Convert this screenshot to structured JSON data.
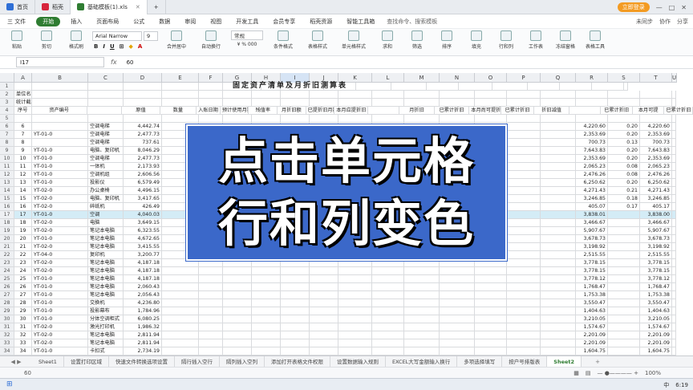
{
  "titlebar": {
    "tabs": [
      {
        "label": "首页",
        "color": "#2f6fd6"
      },
      {
        "label": "稻壳",
        "color": "#d7263d"
      },
      {
        "label": "基础模板(1).xls",
        "color": "#2f7d32"
      }
    ],
    "login_label": "立即登录"
  },
  "menubar": {
    "file": "三 文件",
    "items": [
      "开始",
      "插入",
      "页面布局",
      "公式",
      "数据",
      "审阅",
      "视图",
      "开发工具",
      "会员专享",
      "稻壳资源",
      "智能工具箱"
    ],
    "search": "查找命令、搜索模板",
    "right": [
      "未同步",
      "协作",
      "分享"
    ]
  },
  "ribbon": {
    "paste": "粘贴",
    "cut": "剪切",
    "copy": "复制",
    "format_painter": "格式刷",
    "font_name": "Arial Narrow",
    "font_size": "9",
    "merge": "合并居中",
    "wrap": "自动换行",
    "general": "常规",
    "conditional": "条件格式",
    "table_style": "表格样式",
    "cell_style": "单元格样式",
    "sum": "求和",
    "filter": "筛选",
    "sort": "排序",
    "fill": "填充",
    "row_col": "行和列",
    "worksheet": "工作表",
    "freeze": "冻结窗格",
    "table_tools": "表格工具"
  },
  "formula": {
    "namebox": "I17",
    "fx": "fx",
    "value": "60"
  },
  "columns": [
    "A",
    "B",
    "C",
    "D",
    "E",
    "F",
    "G",
    "H",
    "I",
    "J",
    "K",
    "L",
    "M",
    "N",
    "O",
    "P",
    "Q",
    "R",
    "S",
    "T",
    "U"
  ],
  "sheet": {
    "title": "固定资产清单及月折旧测算表",
    "row2": "单位名称：",
    "row3": "统计截止日：",
    "headers": [
      "序号",
      "资产编号",
      "",
      "原值",
      "数量",
      "入账日期",
      "预计使用月数",
      "残值率",
      "月折旧额",
      "已提折旧月数",
      "本月应提折旧",
      "",
      "月折旧",
      "已累计折旧",
      "本月尚可提折旧额",
      "已累计折旧",
      "折旧减值",
      "",
      "已累计折旧",
      "本月可提",
      "已累计折旧"
    ],
    "rows": [
      {
        "n": "6",
        "no": "6",
        "code": "",
        "name": "空调电梯",
        "orig": "4,442.74",
        "r": "4,220.60",
        "s": "0.20",
        "t": "4,220.60"
      },
      {
        "n": "7",
        "no": "7",
        "code": "YT-01-0",
        "name": "空调电梯",
        "orig": "2,477.73",
        "r": "2,353.69",
        "s": "0.20",
        "t": "2,353.69"
      },
      {
        "n": "8",
        "no": "8",
        "code": "",
        "name": "空调电梯",
        "orig": "737.61",
        "r": "700.73",
        "s": "0.13",
        "t": "700.73"
      },
      {
        "n": "9",
        "no": "9",
        "code": "YT-01-0",
        "name": "电脑、复印机",
        "orig": "8,046.29",
        "r": "7,643.83",
        "s": "0.20",
        "t": "7,643.83"
      },
      {
        "n": "10",
        "no": "10",
        "code": "YT-01-0",
        "name": "空调电梯",
        "orig": "2,477.73",
        "r": "2,353.69",
        "s": "0.20",
        "t": "2,353.69"
      },
      {
        "n": "11",
        "no": "11",
        "code": "YT-01-0",
        "name": "一体机",
        "orig": "2,173.93",
        "r": "2,065.23",
        "s": "0.08",
        "t": "2,065.23"
      },
      {
        "n": "12",
        "no": "12",
        "code": "YT-01-0",
        "name": "空调机组",
        "orig": "2,606.56",
        "r": "2,476.26",
        "s": "0.08",
        "t": "2,476.26"
      },
      {
        "n": "13",
        "no": "13",
        "code": "YT-01-0",
        "name": "投影仪",
        "orig": "6,579.49",
        "r": "6,250.62",
        "s": "0.20",
        "t": "6,250.62"
      },
      {
        "n": "14",
        "no": "14",
        "code": "YT-02-0",
        "name": "办公桌椅",
        "orig": "4,496.15",
        "r": "4,271.43",
        "s": "0.21",
        "t": "4,271.43"
      },
      {
        "n": "15",
        "no": "15",
        "code": "YT-02-0",
        "name": "电脑、复印机",
        "orig": "3,417.65",
        "r": "3,246.85",
        "s": "0.18",
        "t": "3,246.85"
      },
      {
        "n": "16",
        "no": "16",
        "code": "YT-02-0",
        "name": "碎纸机",
        "orig": "426.49",
        "r": "405.07",
        "s": "0.17",
        "t": "405.17"
      },
      {
        "n": "17",
        "no": "17",
        "code": "YT-01-0",
        "name": "空调",
        "orig": "4,040.03",
        "r": "3,838.01",
        "s": "",
        "t": "3,838.00"
      },
      {
        "n": "18",
        "no": "18",
        "code": "YT-02-0",
        "name": "电脑",
        "orig": "3,649.15",
        "r": "3,466.67",
        "s": "",
        "t": "3,466.67"
      },
      {
        "n": "19",
        "no": "19",
        "code": "YT-02-0",
        "name": "笔记本电脑",
        "orig": "6,323.55",
        "r": "5,907.67",
        "s": "",
        "t": "5,907.67"
      },
      {
        "n": "20",
        "no": "20",
        "code": "YT-01-0",
        "name": "笔记本电脑",
        "orig": "4,672.65",
        "r": "3,678.73",
        "s": "",
        "t": "3,678.73"
      },
      {
        "n": "21",
        "no": "21",
        "code": "YT-02-0",
        "name": "笔记本电脑",
        "orig": "3,415.55",
        "r": "3,198.92",
        "s": "",
        "t": "3,198.92"
      },
      {
        "n": "22",
        "no": "22",
        "code": "YT-04-0",
        "name": "复印机",
        "orig": "3,200.77",
        "r": "2,515.55",
        "s": "",
        "t": "2,515.55"
      },
      {
        "n": "23",
        "no": "23",
        "code": "YT-02-0",
        "name": "笔记本电脑",
        "orig": "4,187.18",
        "r": "3,778.15",
        "s": "",
        "t": "3,778.15"
      },
      {
        "n": "24",
        "no": "24",
        "code": "YT-02-0",
        "name": "笔记本电脑",
        "orig": "4,187.18",
        "r": "3,778.15",
        "s": "",
        "t": "3,778.15"
      },
      {
        "n": "25",
        "no": "25",
        "code": "YT-01-0",
        "name": "笔记本电脑",
        "orig": "4,187.18",
        "r": "3,778.12",
        "s": "",
        "t": "3,778.12"
      },
      {
        "n": "26",
        "no": "26",
        "code": "YT-01-0",
        "name": "笔记本电脑",
        "orig": "2,060.43",
        "r": "1,768.47",
        "s": "",
        "t": "1,768.47"
      },
      {
        "n": "27",
        "no": "27",
        "code": "YT-01-0",
        "name": "笔记本电脑",
        "orig": "2,056.43",
        "r": "1,753.38",
        "s": "",
        "t": "1,753.38"
      },
      {
        "n": "28",
        "no": "28",
        "code": "YT-01-0",
        "name": "交换机",
        "orig": "4,236.80",
        "r": "3,550.47",
        "s": "",
        "t": "3,550.47"
      },
      {
        "n": "29",
        "no": "29",
        "code": "YT-01-0",
        "name": "投影幕布",
        "orig": "1,784.96",
        "r": "1,404.63",
        "s": "",
        "t": "1,404.63"
      },
      {
        "n": "30",
        "no": "30",
        "code": "YT-01-0",
        "name": "分体空调柜式",
        "orig": "6,080.25",
        "r": "3,210.05",
        "s": "",
        "t": "3,210.05"
      },
      {
        "n": "31",
        "no": "31",
        "code": "YT-02-0",
        "name": "激光打印机",
        "orig": "1,986.32",
        "r": "1,574.67",
        "s": "",
        "t": "1,574.67"
      },
      {
        "n": "32",
        "no": "32",
        "code": "YT-02-0",
        "name": "笔记本电脑",
        "orig": "2,811.94",
        "r": "2,201.09",
        "s": "",
        "t": "2,201.09"
      },
      {
        "n": "33",
        "no": "33",
        "code": "YT-02-0",
        "name": "笔记本电脑",
        "orig": "2,811.94",
        "r": "2,201.09",
        "s": "",
        "t": "2,201.09"
      },
      {
        "n": "34",
        "no": "34",
        "code": "YT-01-0",
        "name": "卡扣式",
        "orig": "2,734.19",
        "r": "1,604.75",
        "s": "",
        "t": "1,604.75"
      }
    ]
  },
  "overlay": {
    "line1": "点击单元格",
    "line2": "行和列变色"
  },
  "sheets": [
    "Sheet1",
    "设置打印区域",
    "快速文件转换选项设置",
    "隔行插入空行",
    "隔列插入空列",
    "添加打开表格文件权限",
    "设置数据输入规则",
    "EXCEL大写金额输入换行",
    "多项选择填写",
    "按户号排版表",
    "Sheet2"
  ],
  "status": {
    "zoom_label": "60",
    "zoom_pct": "100%"
  },
  "taskbar": {
    "time": "6:19",
    "lang": "中"
  }
}
